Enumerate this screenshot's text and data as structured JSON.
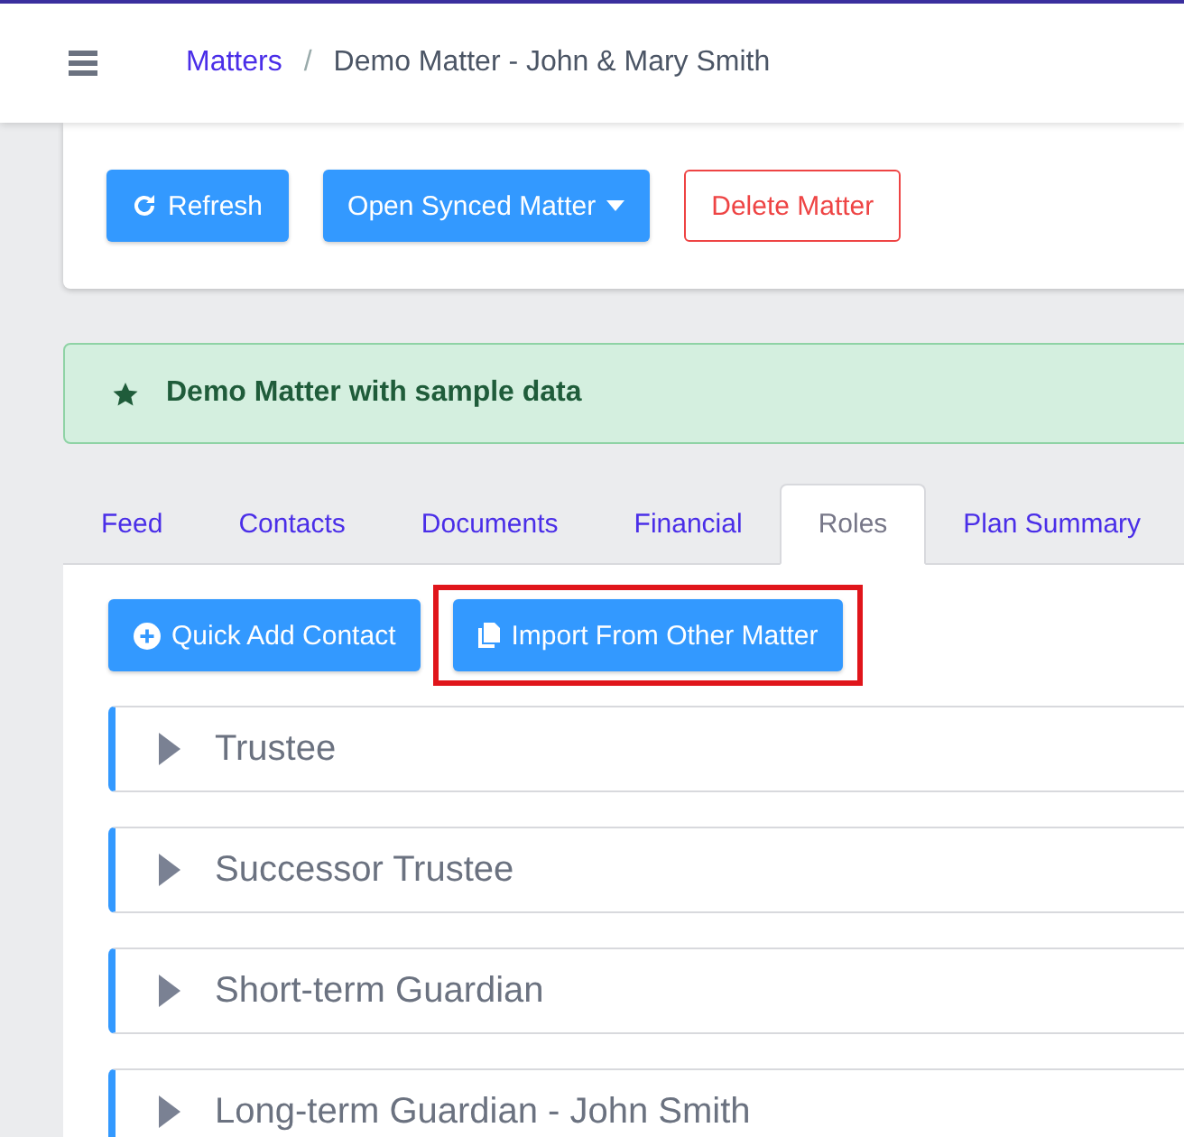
{
  "topbar": {
    "separator": "/",
    "breadcrumb": [
      {
        "label": "Matters",
        "link": true
      },
      {
        "label": "Demo Matter - John & Mary Smith",
        "link": false
      }
    ]
  },
  "actions": [
    {
      "label": "Refresh",
      "kind": "refresh"
    },
    {
      "label": "Open Synced Matter",
      "kind": "dropdown"
    },
    {
      "label": "Delete Matter",
      "kind": "danger"
    }
  ],
  "alert": {
    "text": "Demo Matter with sample data"
  },
  "tabs": [
    {
      "label": "Feed",
      "selected": false
    },
    {
      "label": "Contacts",
      "selected": false
    },
    {
      "label": "Documents",
      "selected": false
    },
    {
      "label": "Financial",
      "selected": false
    },
    {
      "label": "Roles",
      "selected": true
    },
    {
      "label": "Plan Summary",
      "selected": false
    }
  ],
  "role_actions": [
    {
      "label": "Quick Add Contact",
      "kind": "add",
      "highlighted": false
    },
    {
      "label": "Import From Other Matter",
      "kind": "import",
      "highlighted": true
    }
  ],
  "roles": [
    {
      "name": "Trustee",
      "expanded": false
    },
    {
      "name": "Successor Trustee",
      "expanded": false
    },
    {
      "name": "Short-term Guardian",
      "expanded": false
    },
    {
      "name": "Long-term Guardian - John Smith",
      "expanded": false
    }
  ]
}
